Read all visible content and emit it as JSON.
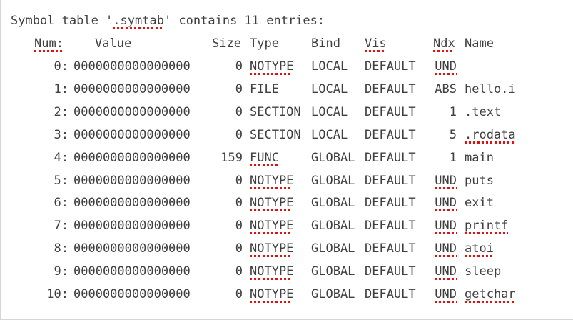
{
  "title": {
    "prefix": "Symbol table '",
    "name": ".symtab",
    "suffix": "' contains 11 entries:"
  },
  "headers": {
    "num": "Num:",
    "value": "Value",
    "size": "Size",
    "type": "Type",
    "bind": "Bind",
    "vis": "Vis",
    "ndx": "Ndx",
    "name": "Name"
  },
  "rows": [
    {
      "num": "0:",
      "value": "0000000000000000",
      "size": "0",
      "type": "NOTYPE",
      "bind": "LOCAL",
      "vis": "DEFAULT",
      "ndx": "UND",
      "name": ""
    },
    {
      "num": "1:",
      "value": "0000000000000000",
      "size": "0",
      "type": "FILE",
      "bind": "LOCAL",
      "vis": "DEFAULT",
      "ndx": "ABS",
      "name": "hello.i"
    },
    {
      "num": "2:",
      "value": "0000000000000000",
      "size": "0",
      "type": "SECTION",
      "bind": "LOCAL",
      "vis": "DEFAULT",
      "ndx": "1",
      "name": ".text"
    },
    {
      "num": "3:",
      "value": "0000000000000000",
      "size": "0",
      "type": "SECTION",
      "bind": "LOCAL",
      "vis": "DEFAULT",
      "ndx": "5",
      "name": ".rodata"
    },
    {
      "num": "4:",
      "value": "0000000000000000",
      "size": "159",
      "type": "FUNC",
      "bind": "GLOBAL",
      "vis": "DEFAULT",
      "ndx": "1",
      "name": "main"
    },
    {
      "num": "5:",
      "value": "0000000000000000",
      "size": "0",
      "type": "NOTYPE",
      "bind": "GLOBAL",
      "vis": "DEFAULT",
      "ndx": "UND",
      "name": "puts"
    },
    {
      "num": "6:",
      "value": "0000000000000000",
      "size": "0",
      "type": "NOTYPE",
      "bind": "GLOBAL",
      "vis": "DEFAULT",
      "ndx": "UND",
      "name": "exit"
    },
    {
      "num": "7:",
      "value": "0000000000000000",
      "size": "0",
      "type": "NOTYPE",
      "bind": "GLOBAL",
      "vis": "DEFAULT",
      "ndx": "UND",
      "name": "printf"
    },
    {
      "num": "8:",
      "value": "0000000000000000",
      "size": "0",
      "type": "NOTYPE",
      "bind": "GLOBAL",
      "vis": "DEFAULT",
      "ndx": "UND",
      "name": "atoi"
    },
    {
      "num": "9:",
      "value": "0000000000000000",
      "size": "0",
      "type": "NOTYPE",
      "bind": "GLOBAL",
      "vis": "DEFAULT",
      "ndx": "UND",
      "name": "sleep"
    },
    {
      "num": "10:",
      "value": "0000000000000000",
      "size": "0",
      "type": "NOTYPE",
      "bind": "GLOBAL",
      "vis": "DEFAULT",
      "ndx": "UND",
      "name": "getchar"
    }
  ],
  "colors": {
    "text": "#3f3f3f",
    "spellcheck_underline": "#e01010",
    "background": "#ffffff",
    "border": "#d6d6d6"
  }
}
